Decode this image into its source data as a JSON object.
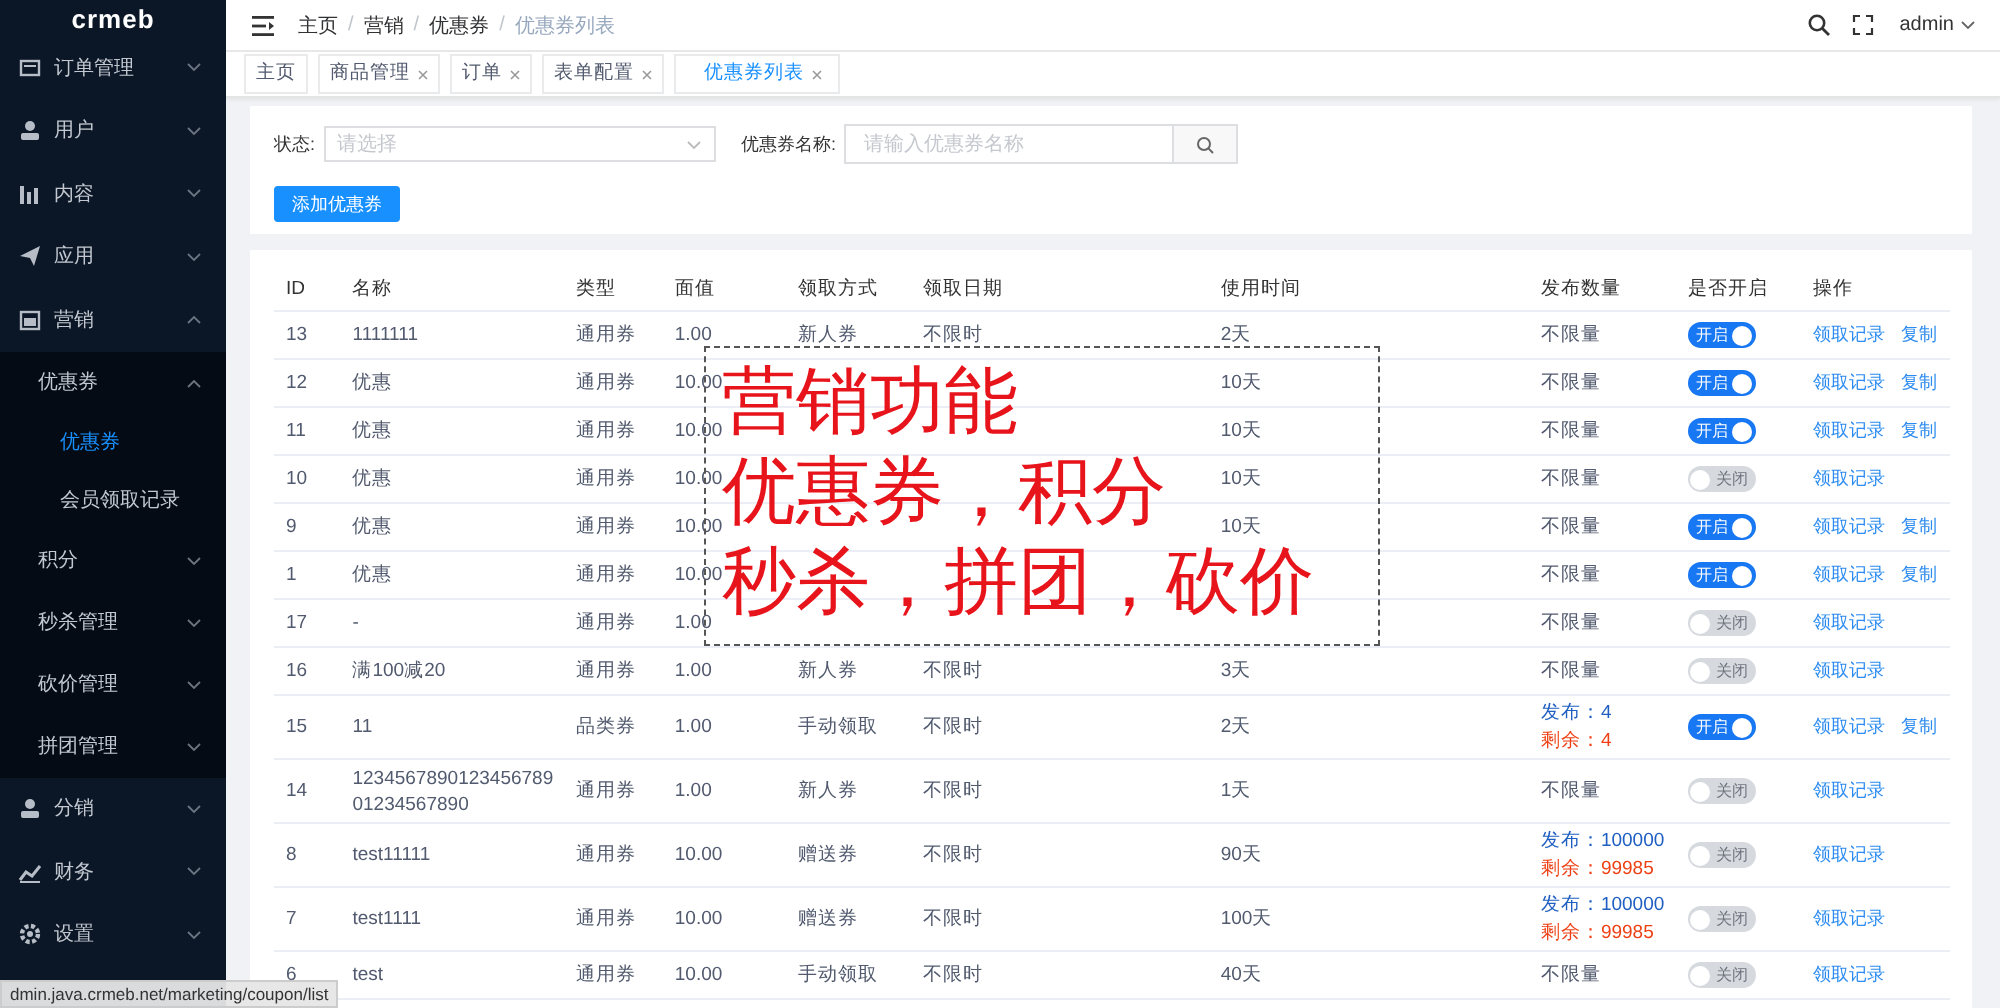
{
  "sidebar": {
    "logo": "crmeb",
    "items": [
      {
        "label": "订单管理",
        "expanded": false
      },
      {
        "label": "用户",
        "expanded": false
      },
      {
        "label": "内容",
        "expanded": false
      },
      {
        "label": "应用",
        "expanded": false
      },
      {
        "label": "营销",
        "expanded": true,
        "children": [
          {
            "label": "优惠券",
            "expanded": true,
            "children": [
              {
                "label": "优惠券",
                "selected": true
              },
              {
                "label": "会员领取记录",
                "selected": false
              }
            ]
          },
          {
            "label": "积分",
            "expanded": false
          },
          {
            "label": "秒杀管理",
            "expanded": false
          },
          {
            "label": "砍价管理",
            "expanded": false
          },
          {
            "label": "拼团管理",
            "expanded": false
          }
        ]
      },
      {
        "label": "分销",
        "expanded": false
      },
      {
        "label": "财务",
        "expanded": false
      },
      {
        "label": "设置",
        "expanded": false
      }
    ]
  },
  "header": {
    "breadcrumb": [
      "主页",
      "营销",
      "优惠券",
      "优惠券列表"
    ],
    "separator": "/",
    "user": "admin"
  },
  "tabs": [
    {
      "label": "主页",
      "closable": false,
      "selected": false
    },
    {
      "label": "商品管理",
      "closable": true,
      "selected": false
    },
    {
      "label": "订单",
      "closable": true,
      "selected": false
    },
    {
      "label": "表单配置",
      "closable": true,
      "selected": false
    },
    {
      "label": "优惠券列表",
      "closable": true,
      "selected": true
    }
  ],
  "filters": {
    "status_label": "状态:",
    "status_placeholder": "请选择",
    "name_label": "优惠券名称:",
    "name_placeholder": "请输入优惠券名称",
    "add_button": "添加优惠券"
  },
  "table": {
    "columns": [
      "ID",
      "名称",
      "类型",
      "面值",
      "领取方式",
      "领取日期",
      "使用时间",
      "发布数量",
      "是否开启",
      "操作"
    ],
    "rows": [
      {
        "id": "13",
        "name": "1111111",
        "type": "通用券",
        "value": "1.00",
        "method": "新人券",
        "date": "不限时",
        "duration": "2天",
        "quantity": {
          "kind": "text",
          "text": "不限量"
        },
        "on": true,
        "switch_text": "开启",
        "actions": [
          "领取记录",
          "复制"
        ]
      },
      {
        "id": "12",
        "name": "优惠",
        "type": "通用券",
        "value": "10.00",
        "duration": "10天",
        "quantity": {
          "kind": "text",
          "text": "不限量"
        },
        "on": true,
        "switch_text": "开启",
        "actions": [
          "领取记录",
          "复制"
        ]
      },
      {
        "id": "11",
        "name": "优惠",
        "type": "通用券",
        "value": "10.00",
        "duration": "10天",
        "quantity": {
          "kind": "text",
          "text": "不限量"
        },
        "on": true,
        "switch_text": "开启",
        "actions": [
          "领取记录",
          "复制"
        ]
      },
      {
        "id": "10",
        "name": "优惠",
        "type": "通用券",
        "value": "10.00",
        "duration": "10天",
        "quantity": {
          "kind": "text",
          "text": "不限量"
        },
        "on": false,
        "switch_text": "关闭",
        "actions": [
          "领取记录"
        ]
      },
      {
        "id": "9",
        "name": "优惠",
        "type": "通用券",
        "value": "10.00",
        "duration": "10天",
        "quantity": {
          "kind": "text",
          "text": "不限量"
        },
        "on": true,
        "switch_text": "开启",
        "actions": [
          "领取记录",
          "复制"
        ]
      },
      {
        "id": "1",
        "name": "优惠",
        "type": "通用券",
        "value": "10.00",
        "quantity": {
          "kind": "text",
          "text": "不限量"
        },
        "on": true,
        "switch_text": "开启",
        "actions": [
          "领取记录",
          "复制"
        ]
      },
      {
        "id": "17",
        "name": "-",
        "type": "通用券",
        "value": "1.00",
        "quantity": {
          "kind": "text",
          "text": "不限量"
        },
        "on": false,
        "switch_text": "关闭",
        "actions": [
          "领取记录"
        ]
      },
      {
        "id": "16",
        "name": "满100减20",
        "type": "通用券",
        "value": "1.00",
        "method": "新人券",
        "date": "不限时",
        "duration": "3天",
        "quantity": {
          "kind": "text",
          "text": "不限量"
        },
        "on": false,
        "switch_text": "关闭",
        "actions": [
          "领取记录"
        ]
      },
      {
        "id": "15",
        "name": "11",
        "type": "品类券",
        "value": "1.00",
        "method": "手动领取",
        "date": "不限时",
        "duration": "2天",
        "quantity": {
          "kind": "counts",
          "published": "发布：4",
          "remaining": "剩余：4"
        },
        "on": true,
        "switch_text": "开启",
        "actions": [
          "领取记录",
          "复制"
        ]
      },
      {
        "id": "14",
        "name": "123456789012345678901234567890",
        "type": "通用券",
        "value": "1.00",
        "method": "新人券",
        "date": "不限时",
        "duration": "1天",
        "quantity": {
          "kind": "text",
          "text": "不限量"
        },
        "on": false,
        "switch_text": "关闭",
        "actions": [
          "领取记录"
        ]
      },
      {
        "id": "8",
        "name": "test11111",
        "type": "通用券",
        "value": "10.00",
        "method": "赠送券",
        "date": "不限时",
        "duration": "90天",
        "quantity": {
          "kind": "counts",
          "published": "发布：100000",
          "remaining": "剩余：99985"
        },
        "on": false,
        "switch_text": "关闭",
        "actions": [
          "领取记录"
        ]
      },
      {
        "id": "7",
        "name": "test1111",
        "type": "通用券",
        "value": "10.00",
        "method": "赠送券",
        "date": "不限时",
        "duration": "100天",
        "quantity": {
          "kind": "counts",
          "published": "发布：100000",
          "remaining": "剩余：99985"
        },
        "on": false,
        "switch_text": "关闭",
        "actions": [
          "领取记录"
        ]
      },
      {
        "id": "6",
        "name": "test",
        "type": "通用券",
        "value": "10.00",
        "method": "手动领取",
        "date": "不限时",
        "duration": "40天",
        "quantity": {
          "kind": "text",
          "text": "不限量"
        },
        "on": false,
        "switch_text": "关闭",
        "actions": [
          "领取记录"
        ]
      }
    ]
  },
  "annotation": {
    "lines": [
      "营销功能",
      "优惠券，积分",
      "秒杀，拼团，砍价"
    ]
  },
  "status_bar": {
    "url": "dmin.java.crmeb.net/marketing/coupon/list"
  }
}
